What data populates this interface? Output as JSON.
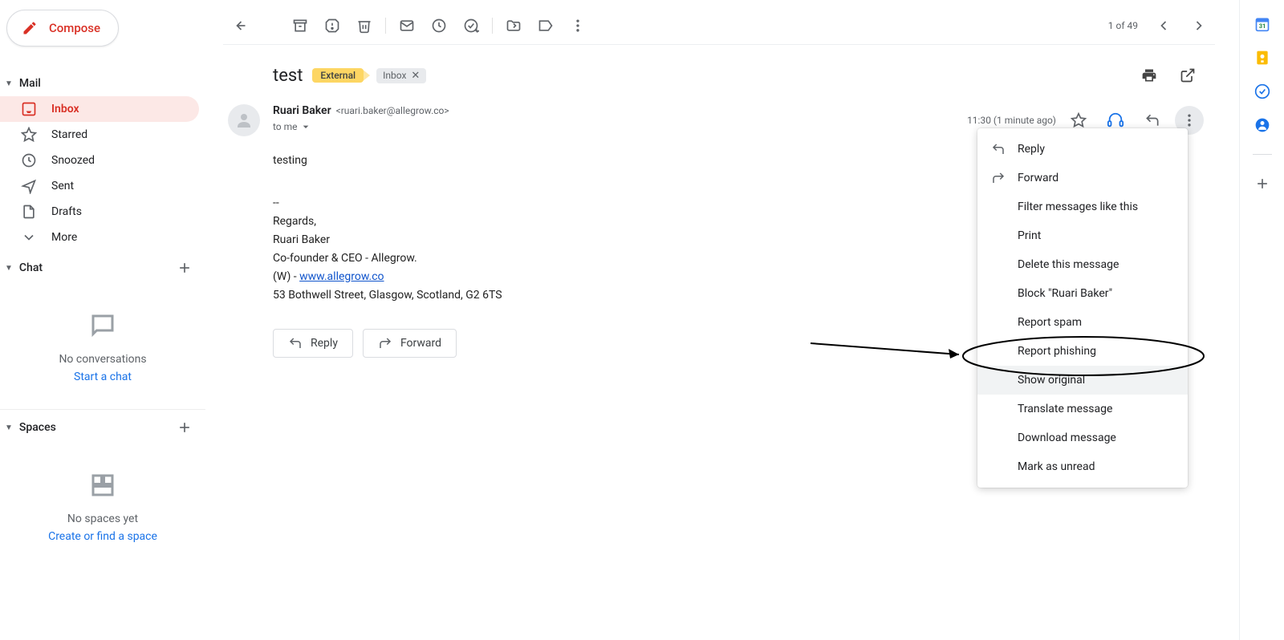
{
  "compose_label": "Compose",
  "sections": {
    "mail": "Mail",
    "chat": "Chat",
    "spaces": "Spaces"
  },
  "nav": {
    "inbox": "Inbox",
    "starred": "Starred",
    "snoozed": "Snoozed",
    "sent": "Sent",
    "drafts": "Drafts",
    "more": "More"
  },
  "chat_placeholder": {
    "line1": "No conversations",
    "line2": "Start a chat"
  },
  "spaces_placeholder": {
    "line1": "No spaces yet",
    "line2": "Create or find a space"
  },
  "toolbar_count": "1 of 49",
  "subject": "test",
  "badge_external": "External",
  "badge_inbox": "Inbox",
  "sender": {
    "name": "Ruari Baker",
    "email": "<ruari.baker@allegrow.co>",
    "to": "to me",
    "time": "11:30 (1 minute ago)"
  },
  "body": {
    "l1": "testing",
    "dash": "--",
    "l2": "Regards,",
    "l3": "Ruari Baker",
    "l4": "Co-founder & CEO - Allegrow.",
    "l5a": "(W) - ",
    "l5b": "www.allegrow.co",
    "l6": "53 Bothwell Street, Glasgow, Scotland, G2 6TS"
  },
  "buttons": {
    "reply": "Reply",
    "forward": "Forward"
  },
  "menu": {
    "reply": "Reply",
    "forward": "Forward",
    "filter": "Filter messages like this",
    "print": "Print",
    "delete": "Delete this message",
    "block": "Block \"Ruari Baker\"",
    "spam": "Report spam",
    "phishing": "Report phishing",
    "show_original": "Show original",
    "translate": "Translate message",
    "download": "Download message",
    "unread": "Mark as unread"
  }
}
